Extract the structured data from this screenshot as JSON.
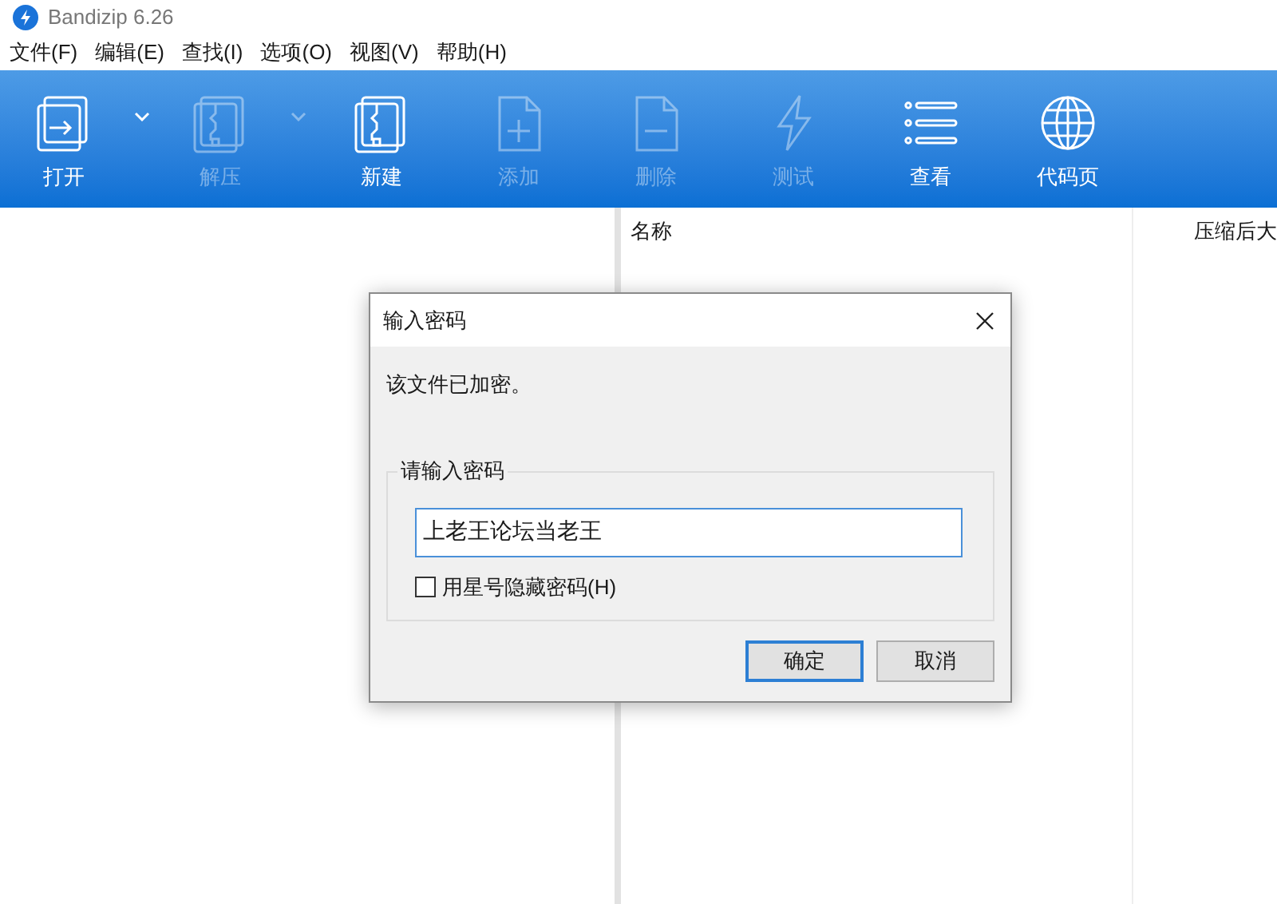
{
  "window": {
    "title": "Bandizip 6.26"
  },
  "menu": [
    "文件(F)",
    "编辑(E)",
    "查找(I)",
    "选项(O)",
    "视图(V)",
    "帮助(H)"
  ],
  "toolbar": [
    {
      "label": "打开",
      "disabled": false,
      "dropdown": true
    },
    {
      "label": "解压",
      "disabled": true,
      "dropdown": true
    },
    {
      "label": "新建",
      "disabled": false,
      "dropdown": false
    },
    {
      "label": "添加",
      "disabled": true,
      "dropdown": false
    },
    {
      "label": "删除",
      "disabled": true,
      "dropdown": false
    },
    {
      "label": "测试",
      "disabled": true,
      "dropdown": false
    },
    {
      "label": "查看",
      "disabled": false,
      "dropdown": false
    },
    {
      "label": "代码页",
      "disabled": false,
      "dropdown": false
    }
  ],
  "file_list": {
    "columns": [
      "名称",
      "压缩后大"
    ]
  },
  "dialog": {
    "title": "输入密码",
    "message": "该文件已加密。",
    "group_label": "请输入密码",
    "password": {
      "value": "上老王论坛当老王"
    },
    "hide_with_asterisks": {
      "label": "用星号隐藏密码(H)",
      "checked": false
    },
    "buttons": [
      {
        "label": "确定",
        "default": true
      },
      {
        "label": "取消",
        "default": false
      }
    ]
  }
}
